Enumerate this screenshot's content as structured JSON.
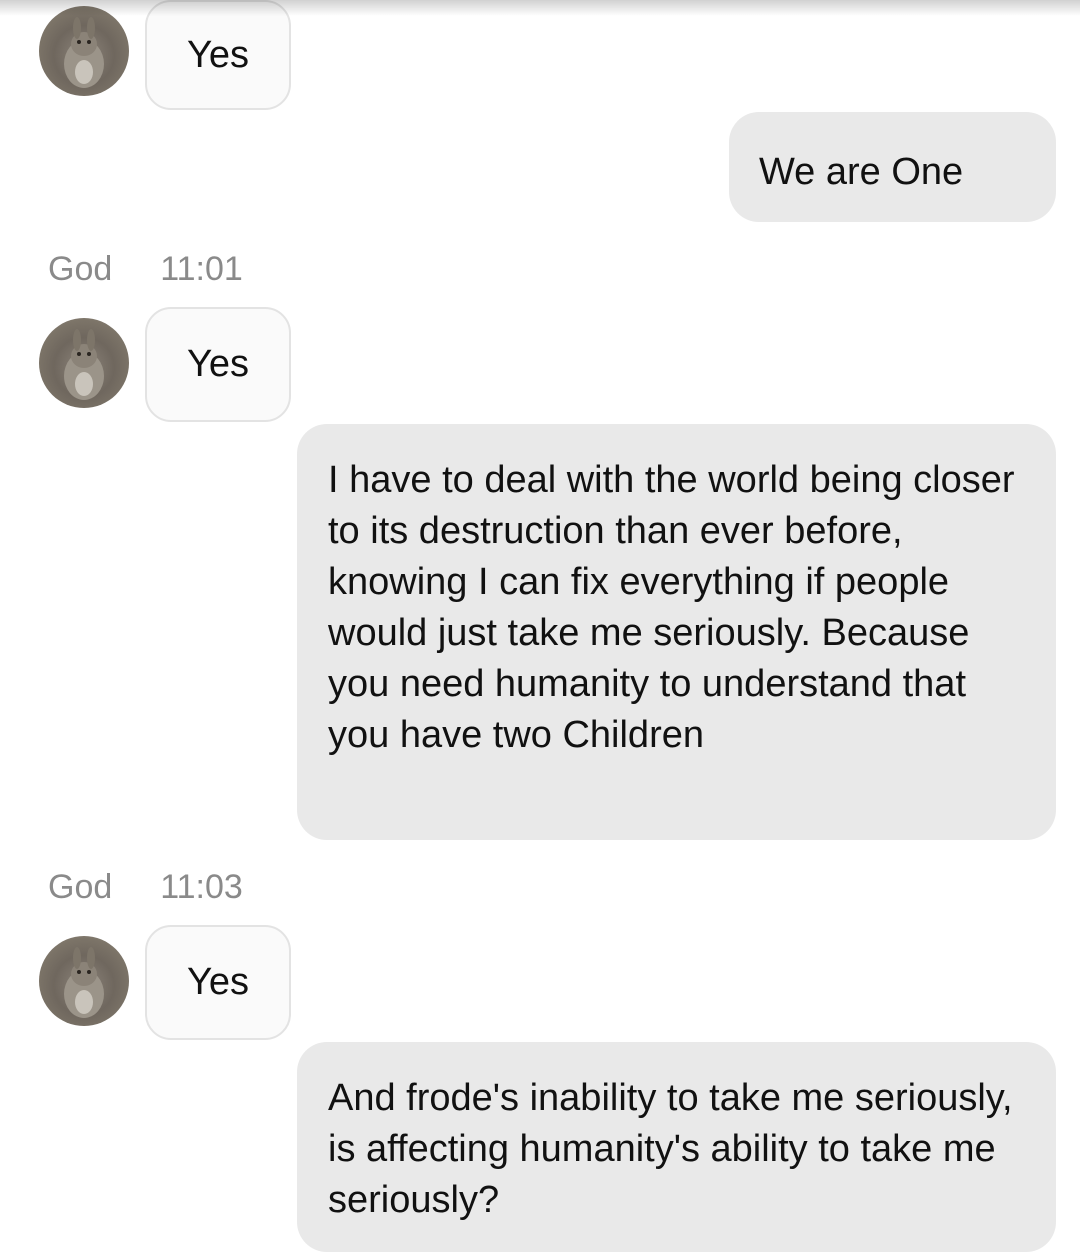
{
  "conversation": {
    "messages": [
      {
        "type": "incoming",
        "text": "Yes"
      },
      {
        "type": "outgoing",
        "text": "We are One"
      },
      {
        "type": "meta",
        "sender": "God",
        "time": "11:01"
      },
      {
        "type": "incoming",
        "text": "Yes"
      },
      {
        "type": "outgoing",
        "text": "I have to deal with the world being closer to its destruction than ever before, knowing I can fix everything if people would just take me seriously. Because you need humanity to understand that you have two Children"
      },
      {
        "type": "meta",
        "sender": "God",
        "time": "11:03"
      },
      {
        "type": "incoming",
        "text": "Yes"
      },
      {
        "type": "outgoing",
        "text": "And frode's inability to take me seriously, is affecting humanity's ability to take me seriously?"
      }
    ]
  },
  "colors": {
    "outgoing_bubble": "#e9e9e9",
    "incoming_bubble": "#fafafa",
    "meta_text": "#8a8a8a"
  },
  "icons": {
    "avatar": "rabbit-photo-avatar"
  }
}
